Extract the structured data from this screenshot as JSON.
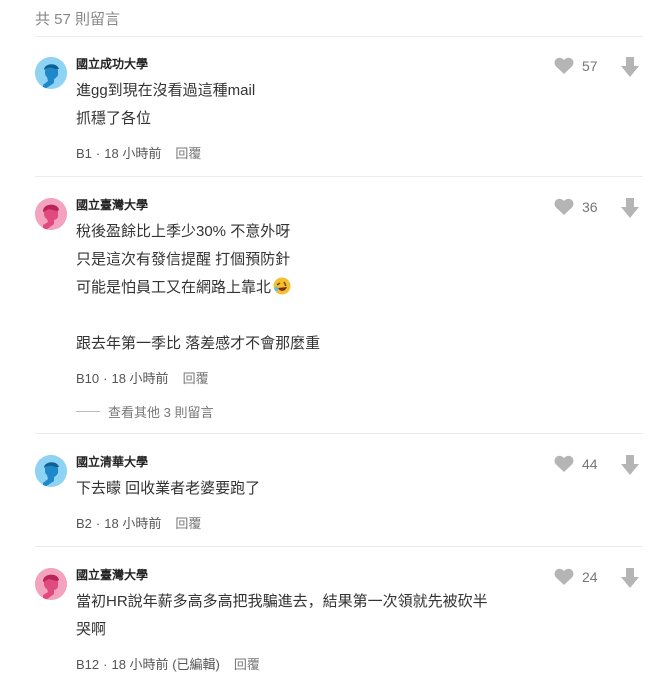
{
  "comment_count": "共 57 則留言",
  "comments": [
    {
      "school": "國立成功大學",
      "lines": [
        "進gg到現在沒看過這種mail",
        "抓穩了各位"
      ],
      "floor": "B1",
      "time": "18 小時前",
      "edited": "",
      "reply": "回覆",
      "likes": "57"
    },
    {
      "school": "國立臺灣大學",
      "lines": [
        "稅後盈餘比上季少30% 不意外呀",
        "只是這次有發信提醒 打個預防針",
        "可能是怕員工又在網路上靠北",
        "",
        "跟去年第一季比 落差感才不會那麼重"
      ],
      "floor": "B10",
      "time": "18 小時前",
      "edited": "",
      "reply": "回覆",
      "likes": "36",
      "more_replies": "查看其他 3 則留言"
    },
    {
      "school": "國立清華大學",
      "lines": [
        "下去矇 回收業者老婆要跑了"
      ],
      "floor": "B2",
      "time": "18 小時前",
      "edited": "",
      "reply": "回覆",
      "likes": "44"
    },
    {
      "school": "國立臺灣大學",
      "lines": [
        "當初HR說年薪多高多高把我騙進去，結果第一次領就先被砍半",
        "哭啊"
      ],
      "floor": "B12",
      "time": "18 小時前",
      "edited": "(已編輯)",
      "reply": "回覆",
      "likes": "24"
    }
  ],
  "icons": {
    "like": "heart-icon",
    "dislike": "down-arrow-icon",
    "emoji": "rolling-laughing-emoji"
  },
  "colors": {
    "avatar_male": "#8fd3f4",
    "avatar_female": "#f4a3bf",
    "icon_gray": "#b5b5b5"
  }
}
